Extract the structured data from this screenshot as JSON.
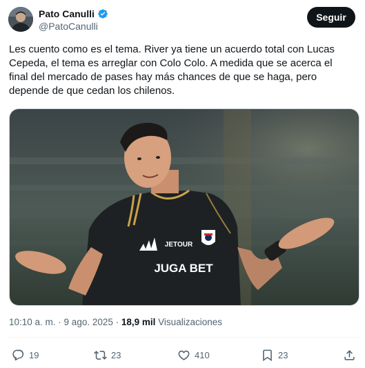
{
  "author": {
    "name": "Pato Canulli",
    "handle": "@PatoCanulli",
    "verified": true
  },
  "follow_button": {
    "label": "Seguir"
  },
  "tweet": {
    "text": "Les cuento como es el tema. River ya tiene un acuerdo total con Lucas Cepeda, el tema es arreglar con Colo Colo. A medida que se acerca el final del mercado de pases hay más chances de que se haga, pero depende de que cedan los chilenos."
  },
  "media": {
    "jersey_sponsor": "JUGA BET",
    "jersey_brand": "JETOUR"
  },
  "meta": {
    "time": "10:10 a. m.",
    "separator": " · ",
    "date": "9 ago. 2025",
    "views_count": "18,9 mil",
    "views_label": "Visualizaciones"
  },
  "actions": {
    "replies": "19",
    "reposts": "23",
    "likes": "410",
    "bookmarks": "23"
  },
  "colors": {
    "text": "#0f1419",
    "secondary": "#536471",
    "verified": "#1d9bf0",
    "button": "#0f1419"
  }
}
